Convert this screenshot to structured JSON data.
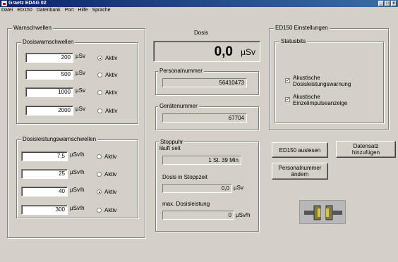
{
  "window": {
    "title": "Graetz EDAG 02",
    "controls": [
      "_",
      "□",
      "×"
    ]
  },
  "menu": [
    "Datei",
    "ED150",
    "Datenbank",
    "Port",
    "Hilfe",
    "Sprache"
  ],
  "warnschwellen": {
    "title": "Warnschwellen",
    "dosis": {
      "title": "Dosiswarnschwellen",
      "unit": "µSv",
      "radio_label": "Aktiv",
      "rows": [
        {
          "value": "200",
          "active": true
        },
        {
          "value": "500",
          "active": false
        },
        {
          "value": "1000",
          "active": false
        },
        {
          "value": "2000",
          "active": false
        }
      ]
    },
    "leistung": {
      "title": "Dosisleistungswarnschwellen",
      "unit": "µSv/h",
      "radio_label": "Aktiv",
      "rows": [
        {
          "value": "7,5",
          "active": false
        },
        {
          "value": "25",
          "active": false
        },
        {
          "value": "40",
          "active": true
        },
        {
          "value": "300",
          "active": false
        }
      ]
    }
  },
  "dosis": {
    "heading": "Dosis",
    "value": "0,0",
    "unit": "µSv",
    "personalnummer_label": "Personalnummer",
    "personalnummer": "56410473",
    "geraetenummer_label": "Gerätenummer",
    "geraetenummer": "67704"
  },
  "stoppuhr": {
    "title": "Stoppuhr",
    "laeuft_label": "läuft seit",
    "laeuft_value": "1 St. 39 Min",
    "dosis_label": "Dosis in Stoppzeit",
    "dosis_value": "0,0",
    "dosis_unit": "µSv",
    "max_label": "max. Dosisleistung",
    "max_value": "0",
    "max_unit": "µSv/h"
  },
  "ed150": {
    "title": "ED150 Einstellungen",
    "statusbits_title": "Statusbits",
    "checkboxes": [
      {
        "label": "Akustische Dosisleistungswarnung",
        "checked": true
      },
      {
        "label": "Akustische Einzelimpulseanzeige",
        "checked": true
      }
    ]
  },
  "buttons": {
    "auslesen": "ED150 auslesen",
    "datensatz": "Datensatz hinzufügen",
    "personalnummer": "Personalnummer ändern"
  },
  "icons": {
    "connector": "port-connector-icon"
  }
}
